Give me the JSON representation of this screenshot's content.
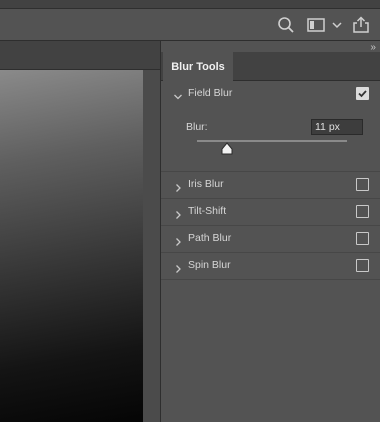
{
  "toolbar": {
    "search_icon": "search-icon",
    "screen_mode_icon": "screen-mode-icon",
    "share_icon": "share-icon"
  },
  "panel": {
    "collapse_glyph": "››",
    "tab_label": "Blur Tools",
    "sections": [
      {
        "label": "Field Blur",
        "expanded": true,
        "checked": true
      },
      {
        "label": "Iris Blur",
        "expanded": false,
        "checked": false
      },
      {
        "label": "Tilt-Shift",
        "expanded": false,
        "checked": false
      },
      {
        "label": "Path Blur",
        "expanded": false,
        "checked": false
      },
      {
        "label": "Spin Blur",
        "expanded": false,
        "checked": false
      }
    ],
    "blur": {
      "label": "Blur:",
      "value": "11 px",
      "slider_fraction": 0.2
    }
  },
  "colors": {
    "background": "#535353",
    "panel_header": "#424242",
    "text": "#d6d6d6"
  }
}
